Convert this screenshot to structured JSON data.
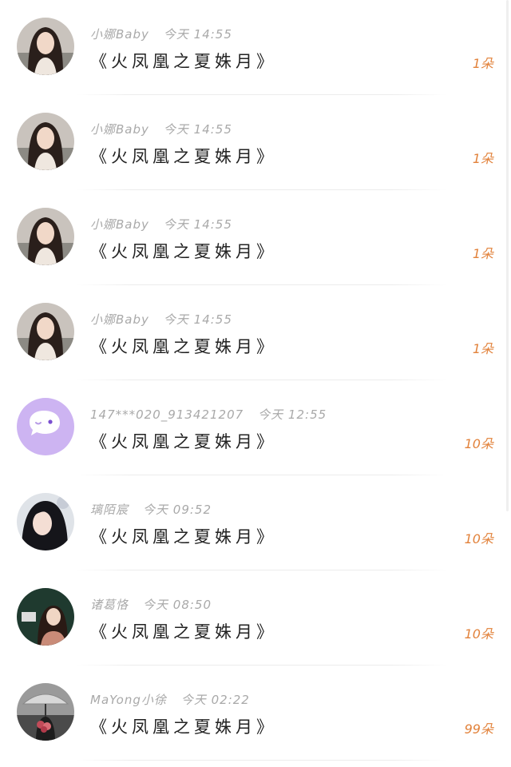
{
  "gifts": [
    {
      "user": "小娜Baby",
      "time": "今天 14:55",
      "title": "《火凤凰之夏姝月》",
      "count": "1朵",
      "avatar": "portrait-woman-long-hair"
    },
    {
      "user": "小娜Baby",
      "time": "今天 14:55",
      "title": "《火凤凰之夏姝月》",
      "count": "1朵",
      "avatar": "portrait-woman-long-hair"
    },
    {
      "user": "小娜Baby",
      "time": "今天 14:55",
      "title": "《火凤凰之夏姝月》",
      "count": "1朵",
      "avatar": "portrait-woman-long-hair"
    },
    {
      "user": "小娜Baby",
      "time": "今天 14:55",
      "title": "《火凤凰之夏姝月》",
      "count": "1朵",
      "avatar": "portrait-woman-long-hair"
    },
    {
      "user": "147***020_913421207",
      "time": "今天 12:55",
      "title": "《火凤凰之夏姝月》",
      "count": "10朵",
      "avatar": "chat-bubble-icon"
    },
    {
      "user": "璃陌宸",
      "time": "今天 09:52",
      "title": "《火凤凰之夏姝月》",
      "count": "10朵",
      "avatar": "portrait-woman-dark-hair"
    },
    {
      "user": "诸葛恪",
      "time": "今天 08:50",
      "title": "《火凤凰之夏姝月》",
      "count": "10朵",
      "avatar": "portrait-woman-poster"
    },
    {
      "user": "MaYong小徐",
      "time": "今天 02:22",
      "title": "《火凤凰之夏姝月》",
      "count": "99朵",
      "avatar": "portrait-umbrella-flowers"
    }
  ],
  "colors": {
    "count": "#e2823b",
    "meta": "#a9a9a9",
    "title": "#222222",
    "bubble_bg": "#cdb4f2"
  }
}
